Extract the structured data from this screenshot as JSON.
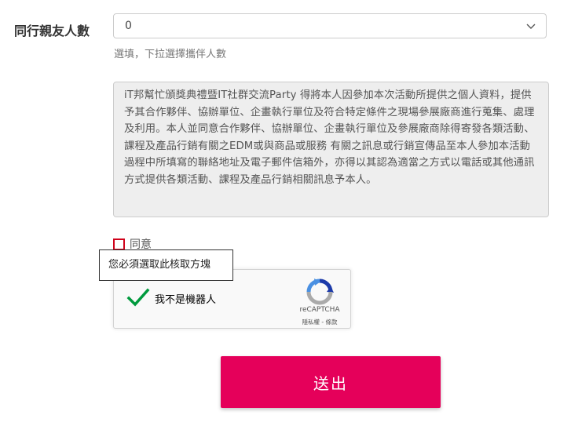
{
  "companions": {
    "label": "同行親友人數",
    "selected_value": "0",
    "help_text": "選填，下拉選擇攜伴人數"
  },
  "terms": {
    "text": "iT邦幫忙頒獎典禮暨IT社群交流Party 得將本人因參加本次活動所提供之個人資料，提供予其合作夥伴、協辦單位、企畫執行單位及符合特定條件之現場參展廠商進行蒐集、處理及利用。本人並同意合作夥伴、協辦單位、企畫執行單位及參展廠商除得寄發各類活動、課程及產品行銷有關之EDM或與商品或服務 有關之訊息或行銷宣傳品至本人參加本活動過程中所填寫的聯絡地址及電子郵件信箱外，亦得以其認為適當之方式以電話或其他通訊方式提供各類活動、課程及產品行銷相關訊息予本人。"
  },
  "agree": {
    "label": "同意",
    "validation_message": "您必須選取此核取方塊"
  },
  "recaptcha": {
    "label": "我不是機器人",
    "brand": "reCAPTCHA",
    "links": "隱私權 - 條款"
  },
  "submit": {
    "label": "送出"
  },
  "colors": {
    "accent": "#e5005a",
    "error": "#d0021b",
    "check": "#009a3d"
  }
}
